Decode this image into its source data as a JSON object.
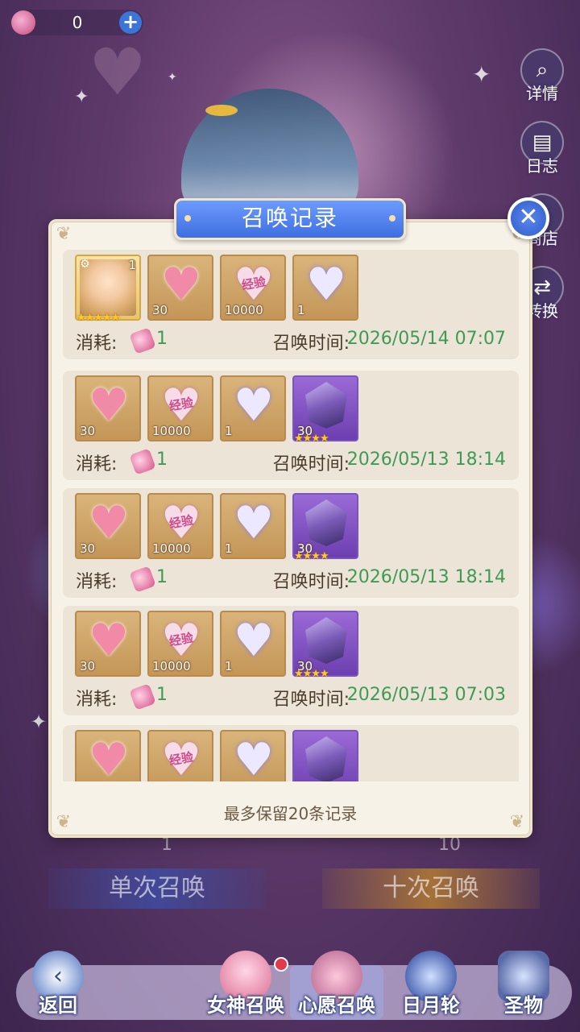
{
  "currency": {
    "value": "0",
    "plus_icon": "plus-icon"
  },
  "side_buttons": [
    {
      "label": "详情",
      "icon": "magnifier-icon"
    },
    {
      "label": "日志",
      "icon": "book-icon"
    },
    {
      "label": "商店",
      "icon": "shop-icon"
    },
    {
      "label": "转换",
      "icon": "convert-icon"
    }
  ],
  "summon": {
    "single_label": "单次召唤",
    "single_cost": "1",
    "ten_label": "十次召唤",
    "ten_cost": "10"
  },
  "dialog": {
    "title": "召唤记录",
    "close_icon": "close-icon",
    "footer": "最多保留20条记录",
    "cost_label": "消耗:",
    "time_label": "召唤时间:",
    "records": [
      {
        "items": [
          {
            "type": "portrait",
            "qty": "1",
            "stars": "★★★★★"
          },
          {
            "type": "heart-pink",
            "qty": "30"
          },
          {
            "type": "exp-heart",
            "qty": "10000",
            "text": "经验"
          },
          {
            "type": "heart-silver",
            "qty": "1"
          }
        ],
        "cost": "1",
        "time": "2026/05/14 07:07"
      },
      {
        "items": [
          {
            "type": "heart-pink",
            "qty": "30"
          },
          {
            "type": "exp-heart",
            "qty": "10000",
            "text": "经验"
          },
          {
            "type": "heart-silver",
            "qty": "1"
          },
          {
            "type": "crystal",
            "qty": "30",
            "stars": "★★★★"
          }
        ],
        "cost": "1",
        "time": "2026/05/13 18:14"
      },
      {
        "items": [
          {
            "type": "heart-pink",
            "qty": "30"
          },
          {
            "type": "exp-heart",
            "qty": "10000",
            "text": "经验"
          },
          {
            "type": "heart-silver",
            "qty": "1"
          },
          {
            "type": "crystal",
            "qty": "30",
            "stars": "★★★★"
          }
        ],
        "cost": "1",
        "time": "2026/05/13 18:14"
      },
      {
        "items": [
          {
            "type": "heart-pink",
            "qty": "30"
          },
          {
            "type": "exp-heart",
            "qty": "10000",
            "text": "经验"
          },
          {
            "type": "heart-silver",
            "qty": "1"
          },
          {
            "type": "crystal",
            "qty": "30",
            "stars": "★★★★"
          }
        ],
        "cost": "1",
        "time": "2026/05/13 07:03"
      },
      {
        "items": [
          {
            "type": "heart-pink",
            "qty": ""
          },
          {
            "type": "exp-heart",
            "qty": "",
            "text": "经验"
          },
          {
            "type": "heart-silver",
            "qty": ""
          },
          {
            "type": "crystal",
            "qty": ""
          }
        ],
        "cost": "",
        "time": ""
      }
    ]
  },
  "bottom_nav": [
    {
      "label": "返回",
      "icon": "back-icon"
    },
    {
      "label": "女神召唤",
      "icon": "goddess-icon"
    },
    {
      "label": "心愿召唤",
      "icon": "wish-heart-icon"
    },
    {
      "label": "日月轮",
      "icon": "sun-moon-wheel-icon"
    },
    {
      "label": "圣物",
      "icon": "relic-icon"
    }
  ],
  "colors": {
    "accent_blue": "#3f6fe0",
    "time_green": "#3f9a55",
    "panel_bg": "#f7f2e8",
    "item_gold": "#c49658",
    "item_purple": "#6c3fb0"
  }
}
